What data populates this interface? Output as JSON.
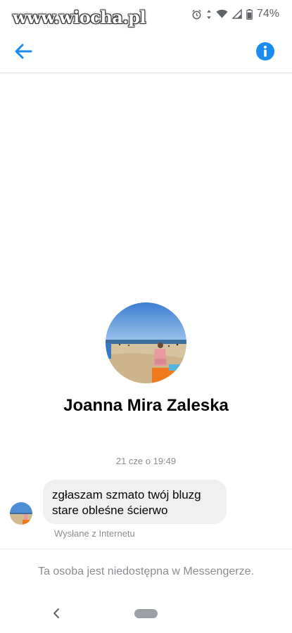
{
  "status_bar": {
    "watermark": "www.wiocha.pl",
    "battery": "74%",
    "icons": [
      "alarm-icon",
      "data-arrows-icon",
      "wifi-icon",
      "signal-icon",
      "battery-icon"
    ]
  },
  "header": {
    "back_icon": "arrow-left-icon",
    "info_icon": "info-icon",
    "accent_color": "#1a8cf0"
  },
  "profile": {
    "name": "Joanna Mira Zaleska"
  },
  "conversation": {
    "timestamp": "21 cze o 19:49",
    "messages": [
      {
        "lines": [
          "zgłaszam szmato twój bluzg",
          "stare obleśne ścierwo"
        ],
        "status": "Wysłane z Internetu"
      }
    ]
  },
  "footer": {
    "unavailable_text": "Ta osoba jest niedostępna w Messengerze."
  },
  "nav": {
    "back_icon": "nav-back-icon",
    "home_icon": "nav-home-pill"
  }
}
